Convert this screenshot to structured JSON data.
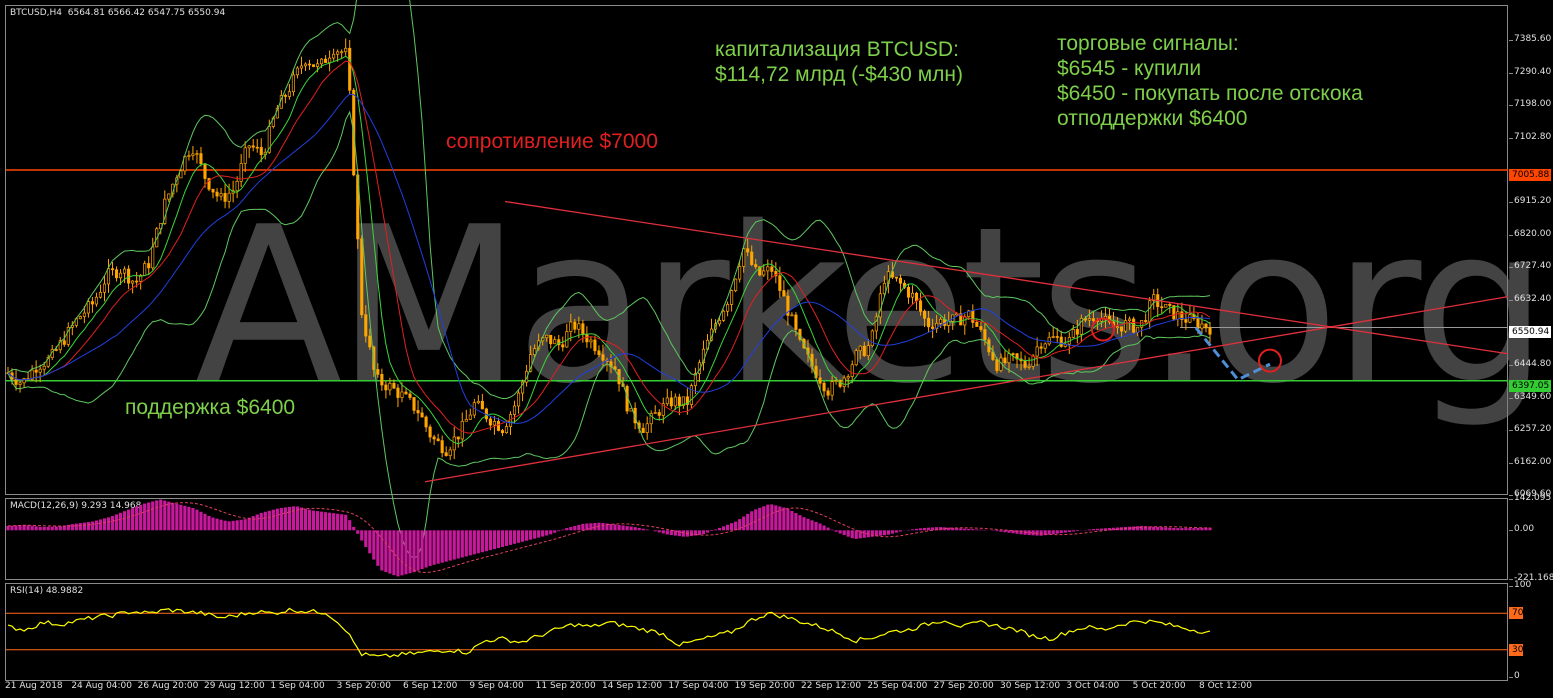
{
  "chart_data": [
    {
      "type": "candlestick",
      "symbol_header": "BTCUSD,H4  6564.81 6566.42 6547.75 6550.94",
      "symbol": "BTCUSD",
      "timeframe": "H4",
      "ohlc_last": {
        "open": 6564.81,
        "high": 6566.42,
        "low": 6547.75,
        "close": 6550.94
      },
      "y_ticks": [
        "7385.60",
        "7290.40",
        "7198.00",
        "7102.80",
        "7005.88",
        "6915.20",
        "6820.00",
        "6727.40",
        "6632.40",
        "6550.94",
        "6444.80",
        "6397.05",
        "6349.60",
        "6257.20",
        "6162.00",
        "6069.60"
      ],
      "ylim": [
        6069.6,
        7480
      ],
      "x_ticks": [
        "21 Aug 2018",
        "24 Aug 04:00",
        "26 Aug 20:00",
        "29 Aug 12:00",
        "1 Sep 04:00",
        "3 Sep 20:00",
        "6 Sep 12:00",
        "9 Sep 04:00",
        "11 Sep 20:00",
        "14 Sep 12:00",
        "17 Sep 04:00",
        "19 Sep 20:00",
        "22 Sep 12:00",
        "25 Sep 04:00",
        "27 Sep 20:00",
        "30 Sep 12:00",
        "3 Oct 04:00",
        "5 Oct 20:00",
        "8 Oct 12:00"
      ],
      "price_profile": [
        6420,
        6390,
        6440,
        6460,
        6520,
        6580,
        6620,
        6700,
        6720,
        6680,
        6740,
        6900,
        7000,
        7080,
        6980,
        6920,
        6950,
        7080,
        7050,
        7180,
        7250,
        7330,
        7300,
        7360,
        7340,
        6600,
        6400,
        6380,
        6350,
        6310,
        6230,
        6200,
        6250,
        6330,
        6290,
        6260,
        6340,
        6480,
        6520,
        6500,
        6560,
        6520,
        6480,
        6430,
        6300,
        6260,
        6310,
        6340,
        6330,
        6460,
        6560,
        6640,
        6780,
        6700,
        6720,
        6620,
        6500,
        6430,
        6370,
        6400,
        6470,
        6500,
        6700,
        6680,
        6640,
        6560,
        6570,
        6570,
        6590,
        6520,
        6440,
        6460,
        6440,
        6510,
        6520,
        6510,
        6570,
        6590,
        6550,
        6560,
        6550,
        6630,
        6600,
        6580,
        6565,
        6551
      ],
      "levels": [
        {
          "label": "7005.88",
          "value": 7005.88,
          "color": "#ff4500"
        },
        {
          "label": "6550.94",
          "value": 6550.94,
          "color": "#ffffff"
        },
        {
          "label": "6397.05",
          "value": 6397.05,
          "color": "#33cc33"
        }
      ]
    },
    {
      "type": "macd",
      "label": "MACD(12,26,9) 9.293 14.968",
      "params": "12,26,9",
      "main_value": 9.293,
      "signal_value": 14.968,
      "y_ticks": [
        "142.095",
        "0.00",
        "-221.168"
      ],
      "ylim": [
        -221.168,
        142.095
      ],
      "color": "#c8189c",
      "histogram_profile": [
        20,
        25,
        15,
        18,
        30,
        40,
        60,
        90,
        120,
        140,
        120,
        100,
        60,
        40,
        50,
        80,
        100,
        110,
        90,
        80,
        70,
        -60,
        -180,
        -210,
        -190,
        -160,
        -140,
        -120,
        -100,
        -80,
        -60,
        -40,
        -20,
        10,
        30,
        35,
        25,
        15,
        0,
        -20,
        -30,
        -20,
        10,
        40,
        90,
        120,
        100,
        60,
        30,
        -10,
        -40,
        -30,
        -20,
        0,
        10,
        15,
        10,
        5,
        0,
        -10,
        -20,
        -25,
        -15,
        -5,
        5,
        10,
        15,
        20,
        15,
        10,
        10,
        12
      ]
    },
    {
      "type": "rsi",
      "label": "RSI(14) 48.9882",
      "period": 14,
      "value": 48.9882,
      "y_ticks": [
        "100",
        "70",
        "30",
        "0"
      ],
      "levels": [
        70,
        30
      ],
      "color": "#ffff00",
      "profile": [
        55,
        52,
        60,
        58,
        62,
        66,
        68,
        72,
        70,
        74,
        72,
        70,
        65,
        68,
        72,
        70,
        74,
        72,
        71,
        55,
        25,
        22,
        24,
        26,
        28,
        30,
        27,
        40,
        42,
        38,
        45,
        52,
        58,
        55,
        60,
        56,
        52,
        48,
        35,
        40,
        45,
        50,
        62,
        70,
        66,
        60,
        55,
        48,
        40,
        44,
        50,
        52,
        58,
        63,
        55,
        60,
        56,
        52,
        45,
        42,
        50,
        55,
        52,
        58,
        62,
        60,
        56,
        52,
        49
      ]
    }
  ],
  "annotations": {
    "capitalization": "капитализация BTCUSD:\n$114,72 млрд (-$430 млн)",
    "signals": "торговые сигналы:\n$6545 - купили\n$6450 - покупать после отскока\nотподдержки $6400",
    "resistance": "сопротивление $7000",
    "support": "поддержка $6400",
    "watermark": "AMarkets.org"
  },
  "colors": {
    "background": "#000000",
    "grid": "#8a8a8a",
    "candle": "#ffa500",
    "resistance": "#ff4500",
    "support": "#33cc33",
    "trendline": "#e0303c",
    "annotation_green": "#7ecf4a",
    "annotation_red": "#e02020",
    "forecast": "#4f8fd6",
    "circle": "#e02020"
  }
}
